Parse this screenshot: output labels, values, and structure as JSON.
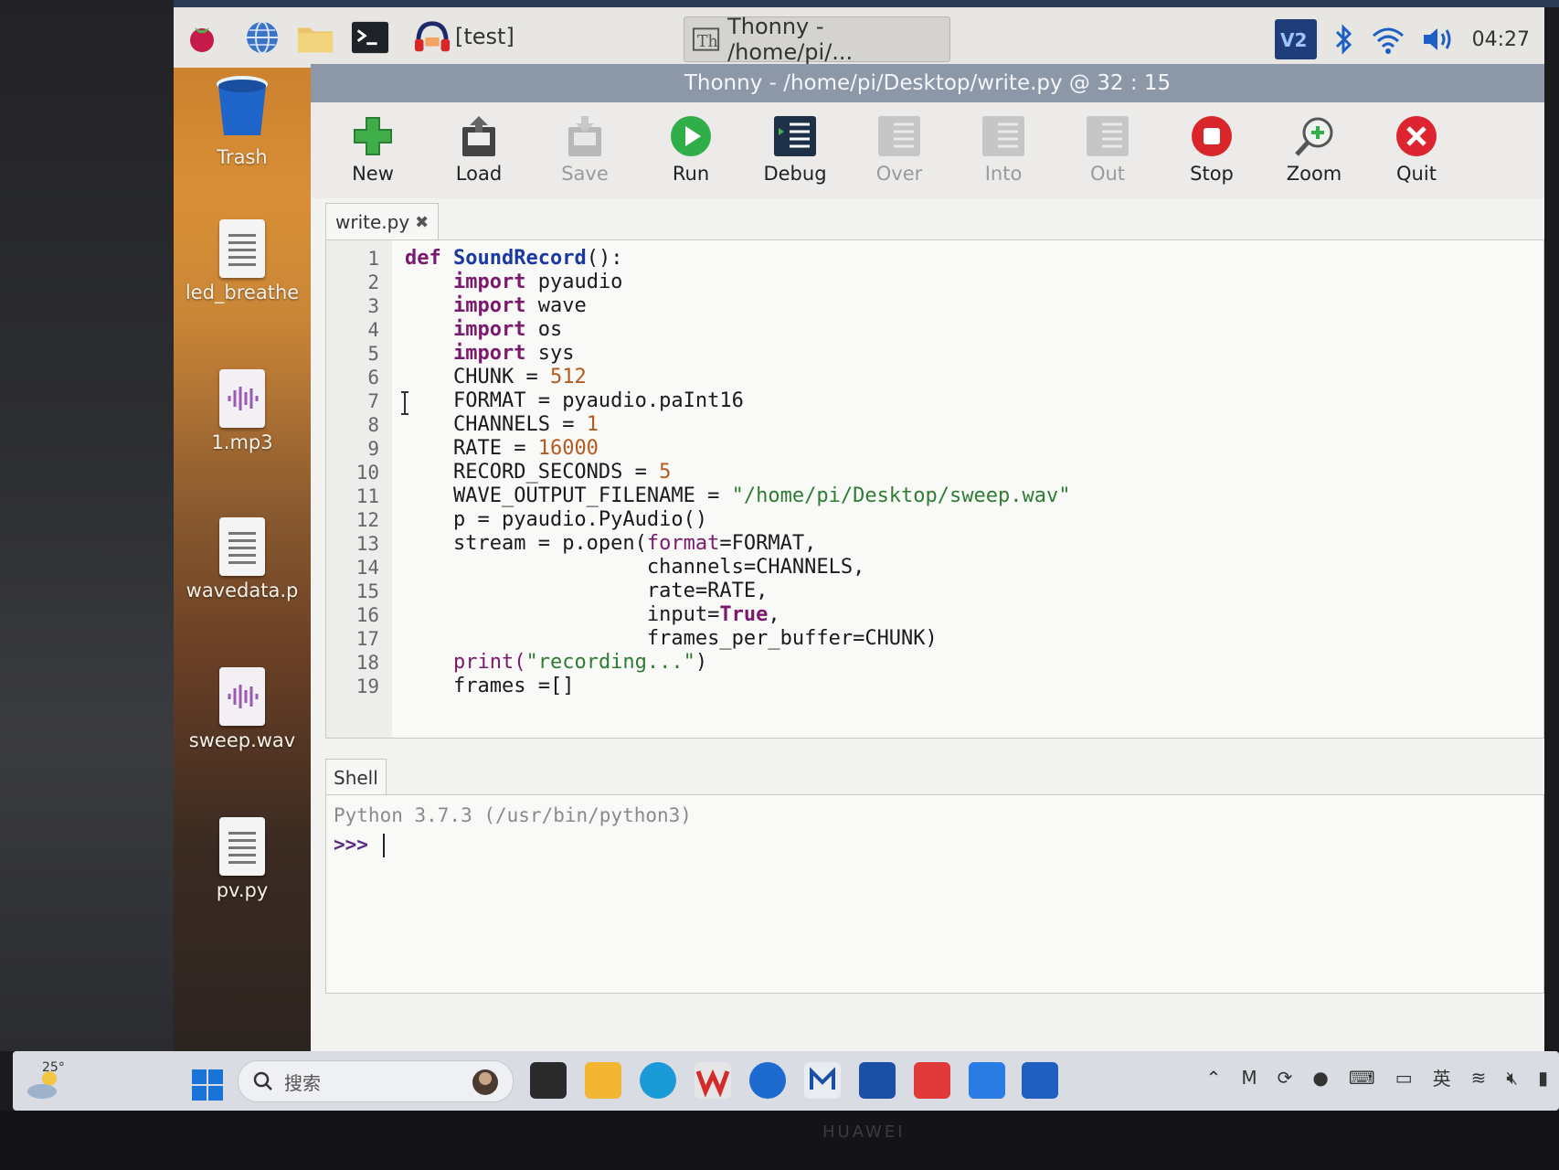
{
  "pi_taskbar": {
    "test_task": "[test]",
    "thonny_task": "Thonny  -  /home/pi/...",
    "clock": "04:27"
  },
  "desktop_icons": [
    {
      "label": "Trash"
    },
    {
      "label": "led_breathe"
    },
    {
      "label": "1.mp3"
    },
    {
      "label": "wavedata.p"
    },
    {
      "label": "sweep.wav"
    },
    {
      "label": "pv.py"
    }
  ],
  "thonny": {
    "title": "Thonny  -  /home/pi/Desktop/write.py  @  32 : 15",
    "toolbar": {
      "new": "New",
      "load": "Load",
      "save": "Save",
      "run": "Run",
      "debug": "Debug",
      "over": "Over",
      "into": "Into",
      "out": "Out",
      "stop": "Stop",
      "zoom": "Zoom",
      "quit": "Quit"
    },
    "editor_tab": "write.py",
    "line_numbers": [
      "1",
      "2",
      "3",
      "4",
      "5",
      "6",
      "7",
      "8",
      "9",
      "10",
      "11",
      "12",
      "13",
      "14",
      "15",
      "16",
      "17",
      "18",
      "19"
    ],
    "code": {
      "l1_kw": "def",
      "l1_name": "SoundRecord",
      "l1_rest": "():",
      "import_kw": "import",
      "l2_mod": " pyaudio",
      "l3_mod": " wave",
      "l4_mod": " os",
      "l5_mod": " sys",
      "l6_a": "CHUNK = ",
      "l6_n": "512",
      "l7": "FORMAT = pyaudio.paInt16",
      "l8_a": "CHANNELS = ",
      "l8_n": "1",
      "l9_a": "RATE = ",
      "l9_n": "16000",
      "l10_a": "RECORD_SECONDS = ",
      "l10_n": "5",
      "l11_a": "WAVE_OUTPUT_FILENAME = ",
      "l11_s": "\"/home/pi/Desktop/sweep.wav\"",
      "l12": "p = pyaudio.PyAudio()",
      "l13_a": "stream = p.open(",
      "l13_k": "format",
      "l13_b": "=FORMAT,",
      "l14": "channels=CHANNELS,",
      "l15": "rate=RATE,",
      "l16_a": "input=",
      "l16_k": "True",
      "l16_b": ",",
      "l17": "frames_per_buffer=CHUNK)",
      "l18_a": "print(",
      "l18_s": "\"recording...\"",
      "l18_b": ")",
      "l19": "frames =[]"
    },
    "shell_tab": "Shell",
    "shell_banner": "Python 3.7.3 (/usr/bin/python3)",
    "shell_prompt": ">>>"
  },
  "windows_taskbar": {
    "weather_temp": "25°",
    "search_placeholder": "搜索",
    "ime_label": "英"
  },
  "bezel_brand": "HUAWEI"
}
